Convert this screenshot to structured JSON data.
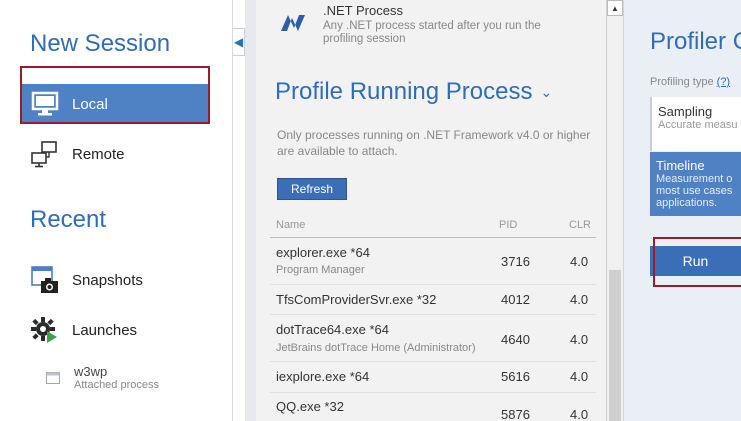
{
  "sidebar": {
    "new_session_title": "New Session",
    "items": [
      {
        "label": "Local",
        "icon": "monitor-icon"
      },
      {
        "label": "Remote",
        "icon": "remote-computers-icon"
      }
    ],
    "recent_title": "Recent",
    "recent_items": [
      {
        "label": "Snapshots",
        "icon": "snapshot-camera-icon"
      },
      {
        "label": "Launches",
        "icon": "launch-gear-icon"
      }
    ],
    "history": {
      "name": "w3wp",
      "sub": "Attached process"
    }
  },
  "net_process": {
    "title": ".NET Process",
    "description": "Any .NET process started after you run the profiling session"
  },
  "profile_running": {
    "title": "Profile Running Process",
    "note": "Only processes running on .NET Framework v4.0 or higher are available to attach.",
    "refresh_label": "Refresh",
    "columns": {
      "name": "Name",
      "pid": "PID",
      "clr": "CLR"
    },
    "rows": [
      {
        "name": "explorer.exe *64",
        "sub": "Program Manager",
        "pid": "3716",
        "clr": "4.0"
      },
      {
        "name": "TfsComProviderSvr.exe *32",
        "sub": "",
        "pid": "4012",
        "clr": "4.0"
      },
      {
        "name": "dotTrace64.exe *64",
        "sub": "JetBrains dotTrace Home (Administrator)",
        "pid": "4640",
        "clr": "4.0"
      },
      {
        "name": "iexplore.exe *64",
        "sub": "",
        "pid": "5616",
        "clr": "4.0"
      },
      {
        "name": "QQ.exe *32",
        "sub": "",
        "pid": "5876",
        "clr": "4.0"
      }
    ]
  },
  "right_panel": {
    "title": "Profiler C",
    "profiling_type_label": "Profiling type",
    "help_link": "(?)",
    "options": [
      {
        "title": "Sampling",
        "desc": "Accurate measu cases"
      },
      {
        "title": "Timeline",
        "desc": "Measurement o most use cases applications."
      }
    ],
    "run_label": "Run"
  },
  "colors": {
    "accent": "#2f6db5",
    "selected": "#4f82c4",
    "highlight_frame": "#9a1c2c"
  }
}
